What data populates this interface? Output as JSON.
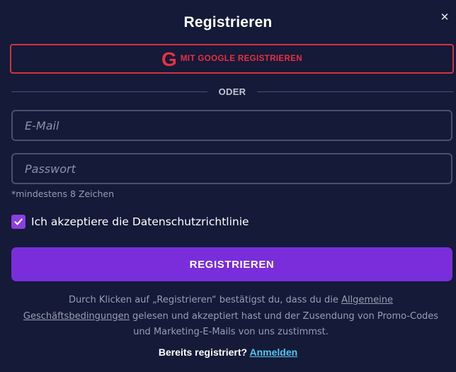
{
  "modal": {
    "title": "Registrieren",
    "close_glyph": "✕"
  },
  "google": {
    "icon": "google-g-icon",
    "icon_glyph": "G",
    "label": "MIT GOOGLE REGISTRIEREN",
    "color": "#ea3043"
  },
  "divider": {
    "label": "ODER"
  },
  "form": {
    "email": {
      "value": "",
      "placeholder": "E-Mail"
    },
    "password": {
      "value": "",
      "placeholder": "Passwort",
      "hint": "*mindestens 8 Zeichen"
    },
    "consent": {
      "checked": true,
      "label": "Ich akzeptiere die Datenschutzrichtlinie"
    },
    "submit_label": "REGISTRIEREN"
  },
  "terms": {
    "before": "Durch Klicken auf „Registrieren“ bestätigst du, dass du die ",
    "link": "Allgemeine Geschäftsbedingungen",
    "after": " gelesen und akzeptiert hast und der Zusendung von Promo-Codes und Marketing-E-Mails von uns zustimmst."
  },
  "footer": {
    "question": "Bereits registriert?",
    "login_label": "Anmelden"
  },
  "colors": {
    "background": "#141a38",
    "accent_purple": "#7a2ddb",
    "google_red": "#ea3043",
    "link_blue": "#4fc8f0"
  }
}
